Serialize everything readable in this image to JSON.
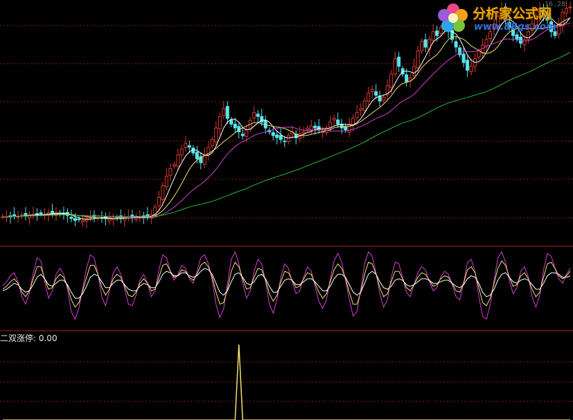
{
  "watermark": {
    "brand": "分析家公式网",
    "url": "www.88gs.com",
    "flower_icon": "flower-logo-icon"
  },
  "top_right_price": "16.28",
  "indicator": {
    "label": "二双涨停: 0.00"
  },
  "colors": {
    "background": "#000000",
    "grid": "#8b1a1a",
    "panel_border": "#b01f1f",
    "candle_up": "#d63a2e",
    "candle_down": "#55e6f0",
    "ma_short": "#ffffff",
    "ma_mid": "#f5e26a",
    "ma_long": "#d23fd2",
    "ma_trend": "#26b83a",
    "osc_fast": "#d23fd2",
    "osc_mid": "#f5e26a",
    "osc_slow": "#ffffff",
    "spike": "#f5e26a"
  },
  "chart_data": [
    {
      "type": "candlestick",
      "panel": "price",
      "x": {
        "count": 150
      },
      "ylim": [
        4.0,
        16.5
      ],
      "series": [
        {
          "type": "candles",
          "close": [
            5.4,
            5.4,
            5.38,
            5.45,
            5.42,
            5.48,
            5.45,
            5.5,
            5.52,
            5.48,
            5.55,
            5.5,
            5.6,
            5.58,
            5.62,
            5.55,
            5.5,
            5.45,
            5.3,
            5.2,
            5.25,
            5.2,
            5.3,
            5.35,
            5.4,
            5.35,
            5.32,
            5.3,
            5.28,
            5.3,
            5.32,
            5.3,
            5.35,
            5.4,
            5.38,
            5.42,
            5.4,
            5.38,
            5.4,
            5.5,
            5.9,
            6.4,
            7.0,
            7.5,
            7.9,
            8.1,
            8.6,
            8.9,
            9.2,
            9.0,
            8.7,
            8.4,
            8.2,
            8.6,
            9.0,
            9.4,
            10.0,
            10.6,
            11.0,
            10.5,
            10.2,
            10.0,
            9.8,
            9.6,
            9.9,
            10.4,
            10.8,
            10.6,
            10.3,
            10.0,
            9.8,
            9.6,
            9.5,
            9.4,
            9.3,
            9.6,
            9.8,
            9.5,
            9.7,
            9.8,
            10.0,
            10.1,
            10.0,
            9.9,
            9.8,
            10.0,
            10.3,
            10.5,
            10.2,
            10.0,
            9.9,
            10.2,
            10.5,
            10.8,
            11.0,
            11.4,
            11.8,
            12.0,
            11.7,
            11.4,
            11.6,
            12.2,
            12.8,
            13.6,
            13.2,
            12.8,
            12.4,
            12.6,
            13.2,
            14.0,
            14.5,
            14.2,
            14.6,
            15.0,
            14.8,
            15.2,
            15.4,
            15.0,
            14.6,
            14.2,
            13.8,
            13.4,
            13.0,
            13.2,
            13.6,
            14.0,
            14.3,
            14.6,
            15.0,
            15.4,
            15.8,
            16.2,
            15.6,
            15.2,
            14.8,
            14.6,
            14.4,
            14.6,
            15.0,
            15.4,
            15.8,
            16.2,
            15.9,
            15.6,
            15.0,
            14.8,
            15.4,
            16.0,
            16.2,
            16.28
          ]
        },
        {
          "name": "",
          "type": "ma",
          "color_key": "ma_short",
          "period": 5
        },
        {
          "name": "",
          "type": "ma",
          "color_key": "ma_mid",
          "period": 10
        },
        {
          "name": "",
          "type": "ma",
          "color_key": "ma_long",
          "period": 20
        },
        {
          "name": "",
          "type": "ma",
          "color_key": "ma_trend",
          "period": 60
        }
      ],
      "grid": true
    },
    {
      "type": "line",
      "panel": "oscillator",
      "x": {
        "count": 150
      },
      "ylim": [
        0,
        100
      ],
      "series": [
        {
          "name": "",
          "color_key": "osc_fast",
          "values": [
            55,
            60,
            68,
            72,
            60,
            40,
            30,
            45,
            72,
            92,
            88,
            60,
            38,
            48,
            70,
            78,
            70,
            50,
            20,
            10,
            25,
            52,
            78,
            96,
            92,
            70,
            40,
            28,
            48,
            72,
            80,
            70,
            50,
            30,
            28,
            42,
            62,
            70,
            58,
            40,
            48,
            76,
            96,
            92,
            74,
            62,
            70,
            82,
            78,
            64,
            58,
            74,
            92,
            96,
            84,
            62,
            30,
            12,
            24,
            58,
            90,
            100,
            84,
            58,
            38,
            48,
            74,
            90,
            84,
            60,
            30,
            18,
            36,
            66,
            84,
            78,
            60,
            44,
            48,
            66,
            80,
            74,
            54,
            34,
            24,
            36,
            64,
            88,
            98,
            86,
            62,
            36,
            14,
            20,
            50,
            84,
            100,
            94,
            72,
            44,
            26,
            36,
            66,
            86,
            84,
            66,
            46,
            40,
            56,
            72,
            80,
            76,
            60,
            48,
            52,
            66,
            74,
            70,
            56,
            40,
            36,
            58,
            86,
            90,
            74,
            40,
            14,
            10,
            30,
            62,
            92,
            100,
            86,
            62,
            44,
            52,
            74,
            80,
            66,
            40,
            26,
            42,
            76,
            98,
            94,
            78,
            64,
            58,
            70,
            78
          ]
        },
        {
          "name": "",
          "color_key": "osc_mid",
          "values": [
            50,
            54,
            60,
            64,
            58,
            46,
            40,
            48,
            64,
            80,
            80,
            64,
            50,
            52,
            64,
            70,
            66,
            54,
            36,
            26,
            32,
            48,
            66,
            82,
            82,
            70,
            52,
            42,
            50,
            64,
            70,
            66,
            54,
            42,
            40,
            46,
            58,
            64,
            58,
            48,
            50,
            66,
            82,
            84,
            74,
            66,
            68,
            76,
            74,
            66,
            62,
            70,
            82,
            86,
            80,
            66,
            46,
            30,
            32,
            50,
            74,
            86,
            80,
            64,
            50,
            52,
            66,
            78,
            76,
            62,
            44,
            34,
            42,
            60,
            74,
            72,
            62,
            52,
            54,
            64,
            72,
            70,
            58,
            46,
            38,
            44,
            60,
            76,
            84,
            78,
            64,
            46,
            30,
            30,
            46,
            70,
            86,
            84,
            70,
            52,
            40,
            44,
            60,
            74,
            74,
            64,
            52,
            48,
            56,
            66,
            72,
            70,
            62,
            54,
            56,
            64,
            68,
            66,
            58,
            48,
            46,
            58,
            76,
            80,
            72,
            52,
            32,
            28,
            38,
            58,
            78,
            88,
            82,
            66,
            54,
            56,
            68,
            72,
            64,
            50,
            40,
            46,
            66,
            84,
            86,
            78,
            68,
            64,
            68,
            74
          ]
        },
        {
          "name": "",
          "color_key": "osc_slow",
          "values": [
            48,
            50,
            54,
            58,
            56,
            50,
            46,
            48,
            56,
            66,
            70,
            64,
            56,
            54,
            58,
            62,
            62,
            56,
            46,
            38,
            38,
            44,
            54,
            66,
            70,
            68,
            60,
            52,
            52,
            58,
            62,
            62,
            56,
            50,
            48,
            48,
            54,
            58,
            56,
            52,
            52,
            60,
            70,
            74,
            72,
            68,
            68,
            72,
            72,
            68,
            66,
            68,
            74,
            78,
            76,
            70,
            58,
            46,
            42,
            48,
            60,
            70,
            72,
            66,
            58,
            56,
            60,
            68,
            70,
            64,
            54,
            46,
            46,
            54,
            62,
            64,
            62,
            56,
            56,
            60,
            64,
            64,
            60,
            54,
            48,
            48,
            54,
            64,
            70,
            70,
            66,
            56,
            46,
            42,
            46,
            58,
            70,
            74,
            70,
            60,
            52,
            50,
            54,
            62,
            64,
            62,
            56,
            54,
            56,
            60,
            64,
            64,
            62,
            58,
            58,
            60,
            62,
            62,
            58,
            54,
            52,
            56,
            64,
            68,
            66,
            58,
            46,
            40,
            42,
            50,
            62,
            70,
            72,
            66,
            60,
            58,
            62,
            64,
            62,
            56,
            50,
            50,
            58,
            68,
            72,
            72,
            70,
            66,
            66,
            68
          ]
        }
      ],
      "grid": false
    },
    {
      "type": "line",
      "panel": "indicator",
      "title": "二双涨停: 0.00",
      "x": {
        "count": 150
      },
      "ylim": [
        0,
        1
      ],
      "series": [
        {
          "name": "二双涨停",
          "color_key": "spike",
          "values": [
            0,
            0,
            0,
            0,
            0,
            0,
            0,
            0,
            0,
            0,
            0,
            0,
            0,
            0,
            0,
            0,
            0,
            0,
            0,
            0,
            0,
            0,
            0,
            0,
            0,
            0,
            0,
            0,
            0,
            0,
            0,
            0,
            0,
            0,
            0,
            0,
            0,
            0,
            0,
            0,
            0,
            0,
            0,
            0,
            0,
            0,
            0,
            0,
            0,
            0,
            0,
            0,
            0,
            0,
            0,
            0,
            0,
            0,
            0,
            0,
            0,
            0,
            1,
            0,
            0,
            0,
            0,
            0,
            0,
            0,
            0,
            0,
            0,
            0,
            0,
            0,
            0,
            0,
            0,
            0,
            0,
            0,
            0,
            0,
            0,
            0,
            0,
            0,
            0,
            0,
            0,
            0,
            0,
            0,
            0,
            0,
            0,
            0,
            0,
            0,
            0,
            0,
            0,
            0,
            0,
            0,
            0,
            0,
            0,
            0,
            0,
            0,
            0,
            0,
            0,
            0,
            0,
            0,
            0,
            0,
            0,
            0,
            0,
            0,
            0,
            0,
            0,
            0,
            0,
            0,
            0,
            0,
            0,
            0,
            0,
            0,
            0,
            0,
            0,
            0,
            0,
            0,
            0,
            0,
            0,
            0,
            0,
            0,
            0,
            0
          ]
        }
      ],
      "grid": true
    }
  ]
}
